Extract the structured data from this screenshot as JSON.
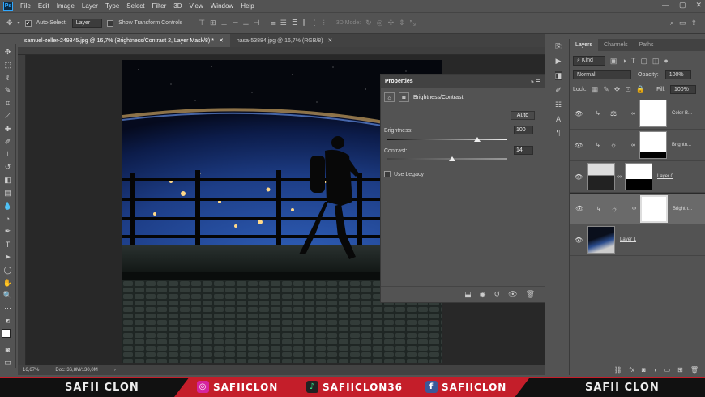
{
  "menu": {
    "items": [
      "File",
      "Edit",
      "Image",
      "Layer",
      "Type",
      "Select",
      "Filter",
      "3D",
      "View",
      "Window",
      "Help"
    ]
  },
  "options": {
    "auto_select_label": "Auto-Select:",
    "auto_select_value": "Layer",
    "transform_label": "Show Transform Controls",
    "mode_label": "3D Mode:"
  },
  "tabs": [
    {
      "label": "samuel-zeller-249345.jpg @ 16,7% (Brightness/Contrast 2, Layer Mask/8) *"
    },
    {
      "label": "nasa-53884.jpg @ 16,7% (RGB/8)"
    }
  ],
  "properties": {
    "title": "Properties",
    "adjustment": "Brightness/Contrast",
    "auto_label": "Auto",
    "brightness_label": "Brightness:",
    "brightness_value": "100",
    "brightness_fraction": 0.75,
    "contrast_label": "Contrast:",
    "contrast_value": "14",
    "contrast_fraction": 0.54,
    "legacy_label": "Use Legacy"
  },
  "layers": {
    "tabs": [
      "Layers",
      "Channels",
      "Paths"
    ],
    "kind_label": "Kind",
    "blend_mode": "Normal",
    "opacity_label": "Opacity:",
    "opacity_value": "100%",
    "lock_label": "Lock:",
    "fill_label": "Fill:",
    "fill_value": "100%",
    "items": [
      {
        "name": "Color B...",
        "type": "color-balance"
      },
      {
        "name": "Brightn...",
        "type": "brightness"
      },
      {
        "name": "Layer 0",
        "type": "pixel"
      },
      {
        "name": "Brightn...",
        "type": "brightness"
      },
      {
        "name": "Layer 1",
        "type": "pixel"
      }
    ]
  },
  "status": {
    "zoom": "16,67%",
    "doc": "Doc: 36,8M/130,0M"
  },
  "banner": {
    "left_name": "SAFII CLON",
    "right_name": "SAFII CLON",
    "instagram": "SAFIICLON",
    "tiktok": "SAFIICLON36",
    "facebook": "SAFIICLON"
  },
  "colors": {
    "accent": "#31a8ff",
    "banner_red": "#c41e2a"
  }
}
